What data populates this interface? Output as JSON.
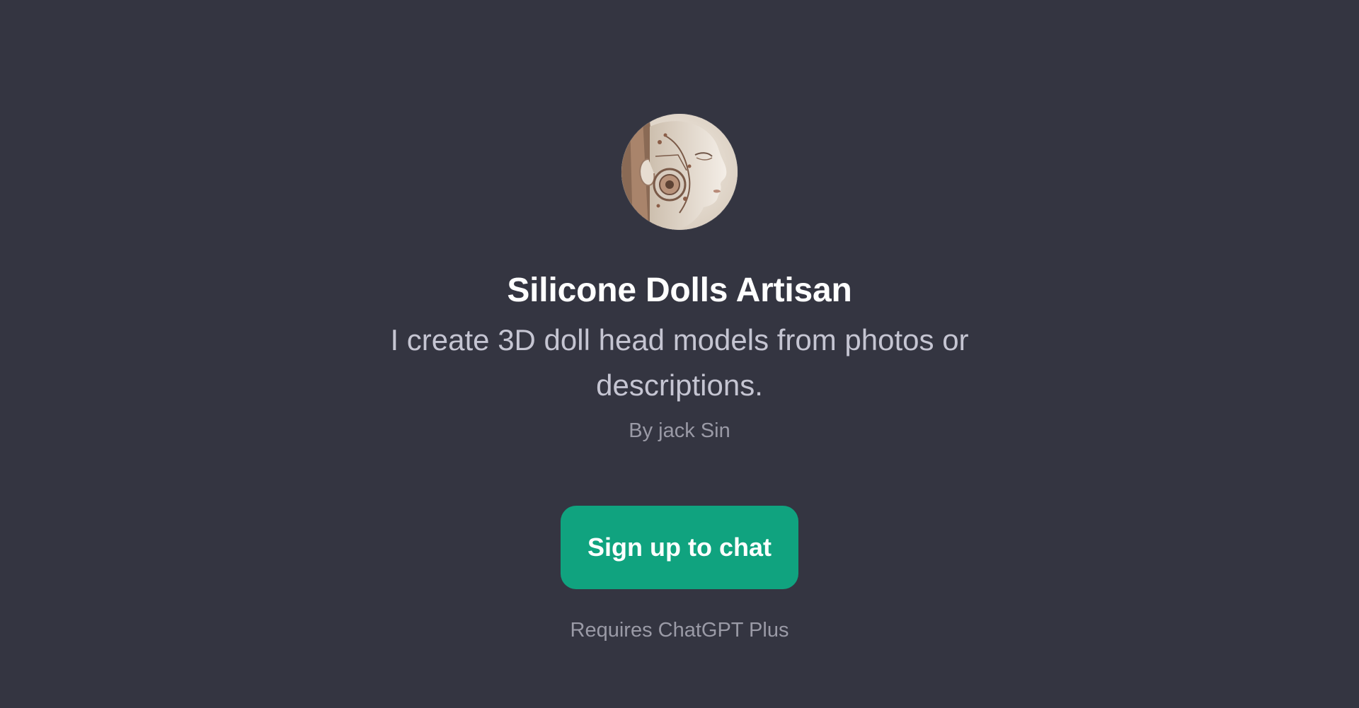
{
  "gpt": {
    "avatar_icon": "robotic-doll-head-portrait",
    "title": "Silicone Dolls Artisan",
    "description": "I create 3D doll head models from photos or descriptions.",
    "author": "By jack Sin"
  },
  "actions": {
    "signup_label": "Sign up to chat",
    "requirement": "Requires ChatGPT Plus"
  },
  "colors": {
    "background": "#343541",
    "accent": "#10a37f",
    "title": "#ffffff",
    "description": "#c5c5d2",
    "muted": "#9a9aa6"
  }
}
